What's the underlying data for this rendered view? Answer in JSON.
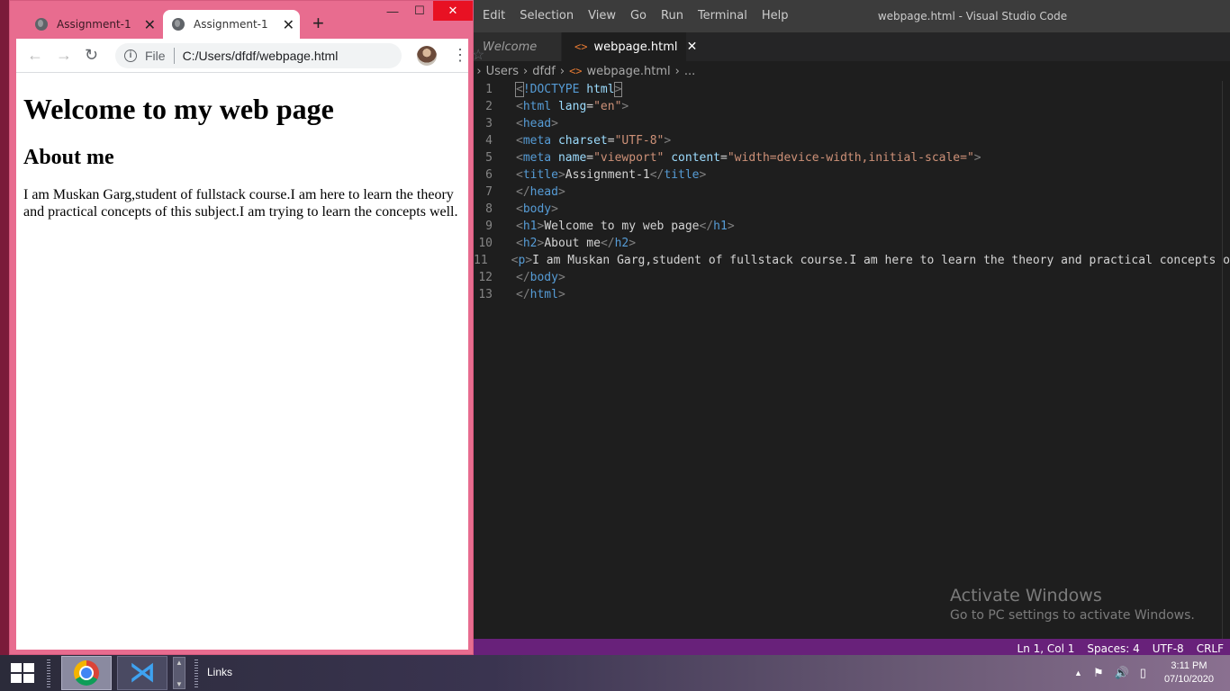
{
  "vscode": {
    "menu": [
      "Edit",
      "Selection",
      "View",
      "Go",
      "Run",
      "Terminal",
      "Help"
    ],
    "title": "webpage.html - Visual Studio Code",
    "tabs": [
      {
        "label": "Welcome",
        "active": false
      },
      {
        "label": "webpage.html",
        "active": true,
        "close": "✕"
      }
    ],
    "breadcrumb": [
      ":",
      "Users",
      "dfdf",
      "webpage.html",
      "..."
    ],
    "line_numbers": [
      "1",
      "2",
      "3",
      "4",
      "5",
      "6",
      "7",
      "8",
      "9",
      "10",
      "11",
      "12",
      "13"
    ],
    "code": {
      "l1": {
        "open": "<",
        "tag": "!DOCTYPE",
        "rest": " html",
        "close": ">"
      },
      "l2": {
        "open": "<",
        "tag": "html",
        "attr": " lang",
        "eq": "=",
        "val": "\"en\"",
        "close": ">"
      },
      "l3": {
        "open": "<",
        "tag": "head",
        "close": ">"
      },
      "l4": {
        "open": "<",
        "tag": "meta",
        "attr": " charset",
        "eq": "=",
        "val": "\"UTF-8\"",
        "close": ">"
      },
      "l5": {
        "open": "<",
        "tag": "meta",
        "attr1": " name",
        "eq1": "=",
        "val1": "\"viewport\"",
        "attr2": " content",
        "eq2": "=",
        "val2": "\"width=device-width,initial-scale=\"",
        "close": ">"
      },
      "l6": {
        "open": "<",
        "tag": "title",
        "close": ">",
        "text": "Assignment-1",
        "open2": "</",
        "tag2": "title",
        "close2": ">"
      },
      "l7": {
        "open": "</",
        "tag": "head",
        "close": ">"
      },
      "l8": {
        "open": "<",
        "tag": "body",
        "close": ">"
      },
      "l9": {
        "open": "<",
        "tag": "h1",
        "close": ">",
        "text": "Welcome to my web page",
        "open2": "</",
        "tag2": "h1",
        "close2": ">"
      },
      "l10": {
        "open": "<",
        "tag": "h2",
        "close": ">",
        "text": "About me",
        "open2": "</",
        "tag2": "h2",
        "close2": ">"
      },
      "l11": {
        "open": "<",
        "tag": "p",
        "close": ">",
        "text": "I am Muskan Garg,student of fullstack course.I am here to learn the theory and practical concepts o"
      },
      "l12": {
        "open": "</",
        "tag": "body",
        "close": ">"
      },
      "l13": {
        "open": "</",
        "tag": "html",
        "close": ">"
      }
    },
    "status": {
      "position": "Ln 1, Col 1",
      "spaces": "Spaces: 4",
      "encoding": "UTF-8",
      "eol": "CRLF"
    },
    "colors": {
      "statusbar": "#68217a",
      "editor_bg": "#1e1e1e"
    }
  },
  "activation": {
    "title": "Activate Windows",
    "subtitle": "Go to PC settings to activate Windows."
  },
  "chrome": {
    "tabs": [
      {
        "title": "Assignment-1",
        "close": "✕"
      },
      {
        "title": "Assignment-1",
        "close": "✕",
        "active": true
      }
    ],
    "new_tab": "+",
    "window_controls": {
      "minimize": "—",
      "maximize": "☐",
      "close": "✕"
    },
    "nav": {
      "back": "←",
      "forward": "→",
      "reload": "↻",
      "star": "☆",
      "menu": "⋮"
    },
    "omnibox": {
      "info": "i",
      "scheme": "File",
      "url": "C:/Users/dfdf/webpage.html"
    },
    "page": {
      "h1": "Welcome to my web page",
      "h2": "About me",
      "p": "I am Muskan Garg,student of fullstack course.I am here to learn the theory and practical concepts of this subject.I am trying to learn the concepts well."
    },
    "colors": {
      "frame": "#e86c8f"
    }
  },
  "taskbar": {
    "links_label": "Links",
    "time": "3:11 PM",
    "date": "07/10/2020",
    "tray_icons": [
      "chevron-up-icon",
      "flag-icon",
      "volume-icon",
      "battery-icon"
    ],
    "tray_glyphs": {
      "chevron": "▲",
      "flag": "⚑",
      "volume": "🔊",
      "battery": "▯"
    }
  }
}
